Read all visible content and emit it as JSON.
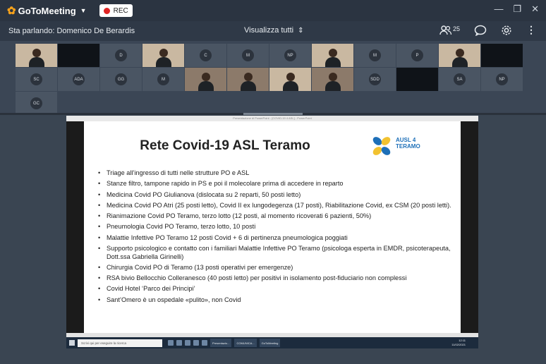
{
  "app": {
    "name": "GoToMeeting",
    "rec_label": "REC",
    "window_controls": [
      "minimize-icon",
      "restore-icon",
      "close-icon"
    ]
  },
  "toolbar": {
    "speaking": "Sta parlando: Domenico De Berardis",
    "view_all": "Visualizza tutti",
    "participants_count": "25"
  },
  "participants": {
    "row1": [
      "",
      "",
      "D",
      "",
      "C",
      "M",
      "NP",
      "",
      "M",
      "P",
      "",
      ""
    ],
    "row2": [
      "SC",
      "ADA",
      "GG",
      "M",
      "",
      "",
      "",
      "",
      "SDD",
      "",
      "SA",
      "NP"
    ],
    "row3": [
      "GC"
    ]
  },
  "presentation": {
    "window_caption": "Presentazione di PowerPoint - [COVID-19 4 ASL] - PowerPoint",
    "title": "Rete Covid-19 ASL Teramo",
    "brand": {
      "line1": "AUSL 4",
      "line2": "TERAMO",
      "sub": ""
    },
    "bullets": [
      "Triage all’ingresso di tutti nelle strutture PO e ASL",
      "Stanze filtro, tampone rapido in PS e poi il molecolare prima di accedere in reparto",
      "Medicina Covid PO Giulianova (dislocata su 2 reparti, 50 posti letto)",
      "Medicina Covid PO Atri (25 posti letto), Covid II ex lungodegenza (17 posti), Riabilitazione Covid, ex CSM (20 posti letti).",
      "Rianimazione Covid PO Teramo, terzo lotto (12 posti, al momento ricoverati 6 pazienti, 50%)",
      "Pneumologia Covid PO Teramo, terzo lotto, 10 posti",
      "Malattie Infettive PO Teramo 12 posti Covid + 6 di pertinenza pneumologica poggiati",
      "Supporto psicologico e contatto con i familiari Malattie Infettive PO Teramo (psicologa esperta in EMDR, psicoterapeuta, Dott.ssa Gabriella Girinelli)",
      "Chirurgia Covid PO di Teramo (13 posti operativi per emergenze)",
      "RSA bivio Bellocchio Colleranesco (40 posti letto) per positivi in isolamento post-fiduciario non complessi",
      "Covid Hotel ‘Parco dei Principi’",
      "Sant’Omero è un ospedale «pulito», non Covid"
    ]
  },
  "taskbar": {
    "search_placeholder": "Scrivi qui per eseguire la ricerca",
    "apps": [
      "Presentazio...",
      "COMUNICA...",
      "GoToMeeting"
    ],
    "clock_time": "12:11",
    "clock_date": "11/02/2021"
  },
  "colors": {
    "accent": "#f7a21b",
    "rec": "#e02424",
    "brand": "#1d6fb8"
  }
}
